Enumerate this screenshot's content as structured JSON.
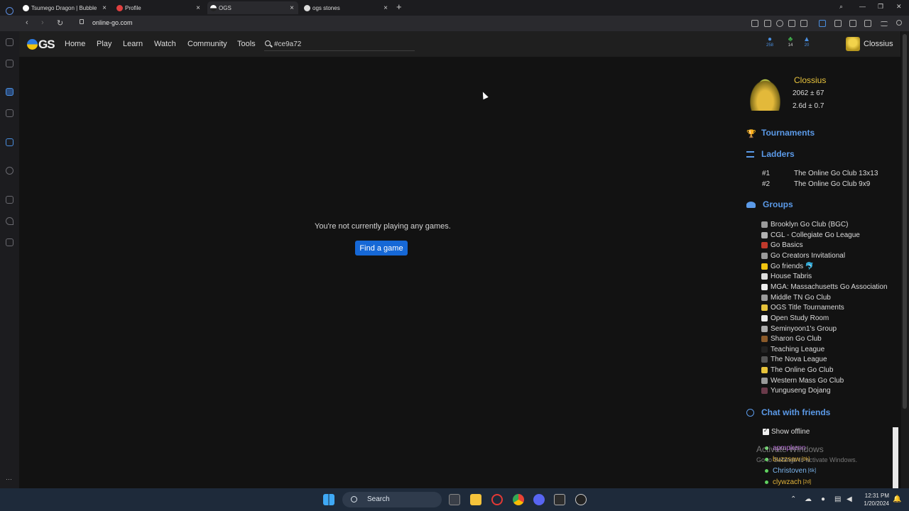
{
  "browser": {
    "tabs": [
      {
        "title": "Tsumego Dragon | Bubble",
        "active": false
      },
      {
        "title": "Profile",
        "active": false
      },
      {
        "title": "OGS",
        "active": true
      },
      {
        "title": "ogs stones",
        "active": false
      }
    ],
    "url": "online-go.com"
  },
  "navbar": {
    "logo": "GS",
    "links": [
      "Home",
      "Play",
      "Learn",
      "Watch",
      "Community",
      "Tools"
    ],
    "search_value": "#ce9a72",
    "counts": {
      "chat": "258",
      "friends": "14",
      "notifications": "20"
    },
    "username": "Clossius"
  },
  "main": {
    "empty_message": "You're not currently playing any games.",
    "find_game_label": "Find a game"
  },
  "profile": {
    "username": "Clossius",
    "rating": "2062 ± 67",
    "rank": "2.6d ± 0.7"
  },
  "tournaments": {
    "title": "Tournaments"
  },
  "ladders": {
    "title": "Ladders",
    "items": [
      {
        "rank": "#1",
        "name": "The Online Go Club 13x13"
      },
      {
        "rank": "#2",
        "name": "The Online Go Club 9x9"
      }
    ]
  },
  "groups": {
    "title": "Groups",
    "items": [
      "Brooklyn Go Club (BGC)",
      "CGL - Collegiate Go League",
      "Go Basics",
      "Go Creators Invitational",
      "Go friends 🐬",
      "House Tabris",
      "MGA: Massachusetts Go Association",
      "Middle TN Go Club",
      "OGS Title Tournaments",
      "Open Study Room",
      "Seminyoon1's Group",
      "Sharon Go Club",
      "Teaching League",
      "The Nova League",
      "The Online Go Club",
      "Western Mass Go Club",
      "Yunguseng Dojang"
    ]
  },
  "chat": {
    "title": "Chat with friends",
    "show_offline": "Show offline",
    "friends": [
      {
        "name": "apmpkenn",
        "rank": "",
        "color": "#b46bd6"
      },
      {
        "name": "buzzsaw",
        "rank": "[9k]",
        "color": "#e0b23a"
      },
      {
        "name": "Christoven",
        "rank": "[6k]",
        "color": "#7db7f0"
      },
      {
        "name": "clywzach",
        "rank": "[2d]",
        "color": "#e0b23a"
      }
    ]
  },
  "watermark": {
    "title": "Activate Windows",
    "subtitle": "Go to Settings to activate Windows."
  },
  "taskbar": {
    "search": "Search",
    "time": "12:31 PM",
    "date": "1/20/2024"
  }
}
